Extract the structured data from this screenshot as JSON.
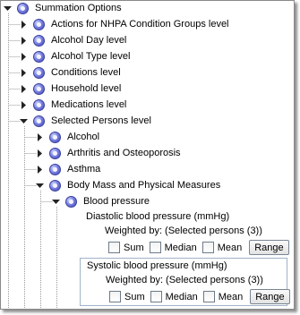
{
  "tree": {
    "root": "Summation Options",
    "level1": [
      "Actions for NHPA Condition Groups level",
      "Alcohol Day level",
      "Alcohol Type level",
      "Conditions level",
      "Household level",
      "Medications level",
      "Selected Persons level"
    ],
    "level2": [
      "Alcohol",
      "Arthritis and Osteoporosis",
      "Asthma",
      "Body Mass and Physical Measures"
    ],
    "level3": [
      "Blood pressure"
    ]
  },
  "measures": [
    {
      "title": "Diastolic blood pressure (mmHg)",
      "weighted": "Weighted by: (Selected persons (3))",
      "options": [
        "Sum",
        "Median",
        "Mean"
      ],
      "button": "Range"
    },
    {
      "title": "Systolic blood pressure (mmHg)",
      "weighted": "Weighted by: (Selected persons (3))",
      "options": [
        "Sum",
        "Median",
        "Mean"
      ],
      "button": "Range"
    }
  ]
}
